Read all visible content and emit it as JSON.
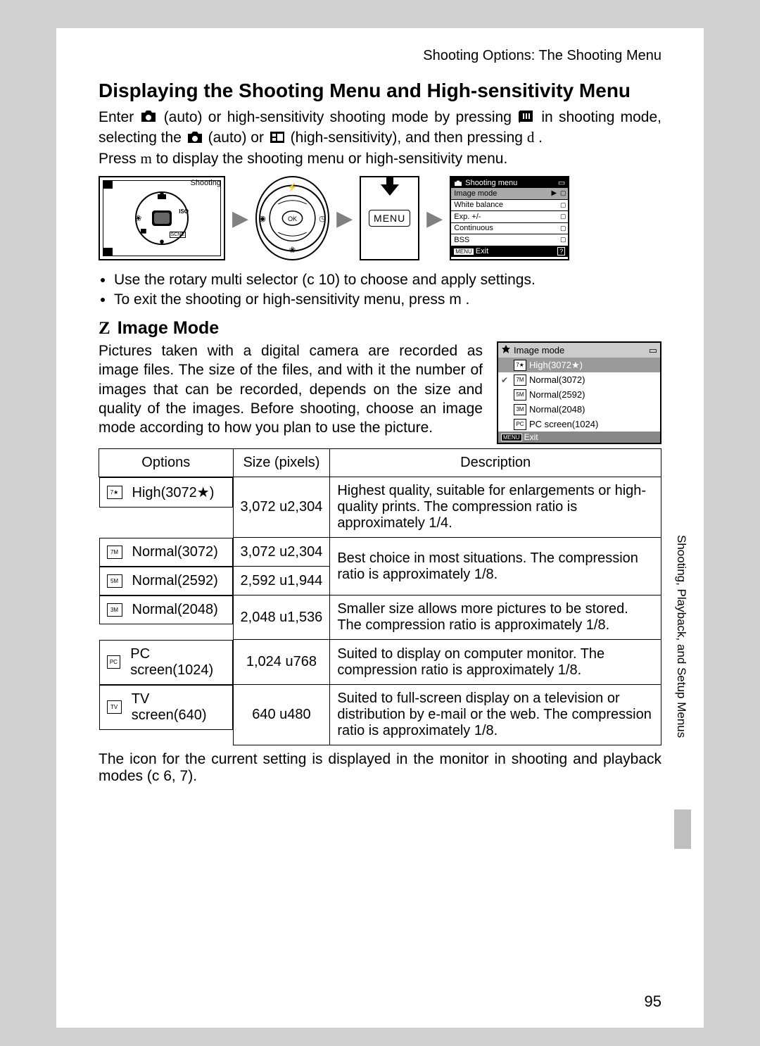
{
  "breadcrumb": "Shooting Options: The Shooting Menu",
  "h1": "Displaying the Shooting Menu and High-sensitivity Menu",
  "intro": {
    "p1a": "Enter ",
    "p1b": " (auto) or high-sensitivity shooting mode by pressing ",
    "p1c": " in shooting mode, selecting the ",
    "p1d": " (auto) or ",
    "p1e": " (high-sensitivity), and then pressing ",
    "p1f": ".",
    "p2a": "Press ",
    "p2b": " to display the shooting menu or high-sensitivity menu.",
    "d": "d",
    "m": "m"
  },
  "fig1_label": "Shooting",
  "fig3_label": "MENU",
  "shooting_menu": {
    "title": "Shooting menu",
    "items": [
      "Image mode",
      "White balance",
      "Exp. +/-",
      "Continuous",
      "BSS"
    ],
    "exit": "Exit"
  },
  "bullets": [
    "Use the rotary multi selector (c 10) to choose and apply settings.",
    "To exit the shooting or high-sensitivity menu, press m ."
  ],
  "h2_prefix": "Z",
  "h2": "Image Mode",
  "image_mode_text": "Pictures taken with a digital camera are recorded as image files. The size of the files, and with it the number of images that can be recorded, depends on the size and quality of the images. Before shooting, choose an image mode according to how you plan to use the picture.",
  "image_mode_panel": {
    "header": "Image mode",
    "items": [
      {
        "label": "High(3072★)",
        "sel": true,
        "icon": "7★"
      },
      {
        "label": "Normal(3072)",
        "sel": false,
        "icon": "7M",
        "check": true
      },
      {
        "label": "Normal(2592)",
        "sel": false,
        "icon": "5M"
      },
      {
        "label": "Normal(2048)",
        "sel": false,
        "icon": "3M"
      },
      {
        "label": "PC screen(1024)",
        "sel": false,
        "icon": "PC"
      }
    ],
    "exit": "Exit"
  },
  "table": {
    "headers": [
      "Options",
      "Size (pixels)",
      "Description"
    ],
    "rows": [
      {
        "icon": "7★",
        "opt": "High(3072★)",
        "size": "3,072 u2,304",
        "desc": "Highest quality, suitable for enlargements or high-quality prints. The compression ratio is approximately 1/4."
      },
      {
        "icon": "7M",
        "opt": "Normal(3072)",
        "size": "3,072 u2,304",
        "desc": "Best choice in most situations. The compression ratio is approximately 1/8.",
        "group_start": true
      },
      {
        "icon": "5M",
        "opt": "Normal(2592)",
        "size": "2,592 u1,944",
        "group_cont": true
      },
      {
        "icon": "3M",
        "opt": "Normal(2048)",
        "size": "2,048 u1,536",
        "desc": "Smaller size allows more pictures to be stored. The compression ratio is approximately 1/8."
      },
      {
        "icon": "PC",
        "opt": "PC screen(1024)",
        "size": "1,024 u768",
        "desc": "Suited to display on computer monitor. The compression ratio is approximately 1/8."
      },
      {
        "icon": "TV",
        "opt": "TV screen(640)",
        "size": "640 u480",
        "desc": "Suited to full-screen display on a television or distribution by e-mail or the web. The compression ratio is approximately 1/8."
      }
    ]
  },
  "footer_text": "The icon for the current setting is displayed in the monitor in shooting and playback modes (c 6, 7).",
  "page_number": "95",
  "side_label": "Shooting, Playback, and Setup Menus"
}
